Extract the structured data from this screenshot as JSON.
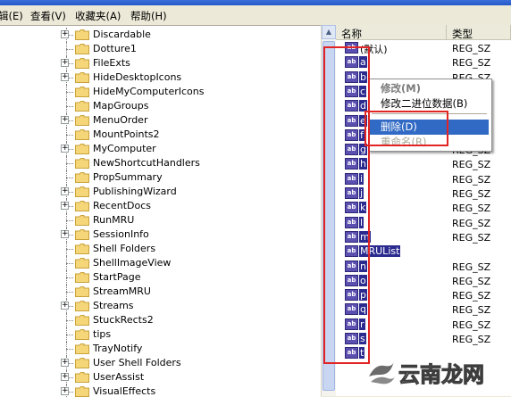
{
  "menubar": {
    "items": [
      {
        "label": "辑(E)",
        "accel_key": "E"
      },
      {
        "label": "查看(V)",
        "accel_key": "V"
      },
      {
        "label": "收藏夹(A)",
        "accel_key": "A"
      },
      {
        "label": "帮助(H)",
        "accel_key": "H"
      }
    ]
  },
  "tree": {
    "items": [
      {
        "label": "Discardable",
        "expandable": true
      },
      {
        "label": "Dotture1",
        "expandable": false
      },
      {
        "label": "FileExts",
        "expandable": true
      },
      {
        "label": "HideDesktopIcons",
        "expandable": true
      },
      {
        "label": "HideMyComputerIcons",
        "expandable": false
      },
      {
        "label": "MapGroups",
        "expandable": false
      },
      {
        "label": "MenuOrder",
        "expandable": true
      },
      {
        "label": "MountPoints2",
        "expandable": false
      },
      {
        "label": "MyComputer",
        "expandable": true
      },
      {
        "label": "NewShortcutHandlers",
        "expandable": false
      },
      {
        "label": "PropSummary",
        "expandable": false
      },
      {
        "label": "PublishingWizard",
        "expandable": true
      },
      {
        "label": "RecentDocs",
        "expandable": true
      },
      {
        "label": "RunMRU",
        "expandable": false
      },
      {
        "label": "SessionInfo",
        "expandable": true
      },
      {
        "label": "Shell Folders",
        "expandable": false
      },
      {
        "label": "ShellImageView",
        "expandable": false
      },
      {
        "label": "StartPage",
        "expandable": false
      },
      {
        "label": "StreamMRU",
        "expandable": false
      },
      {
        "label": "Streams",
        "expandable": true
      },
      {
        "label": "StuckRects2",
        "expandable": false
      },
      {
        "label": "tips",
        "expandable": false
      },
      {
        "label": "TrayNotify",
        "expandable": false
      },
      {
        "label": "User Shell Folders",
        "expandable": true
      },
      {
        "label": "UserAssist",
        "expandable": true
      },
      {
        "label": "VisualEffects",
        "expandable": true
      }
    ]
  },
  "list": {
    "headers": {
      "name": "名称",
      "type": "类型"
    },
    "icon_text": "ab",
    "rows": [
      {
        "name": "(默认)",
        "type": "REG_SZ",
        "selected": false
      },
      {
        "name": "a",
        "type": "REG_SZ",
        "selected": true
      },
      {
        "name": "b",
        "type": "REG_SZ",
        "selected": true
      },
      {
        "name": "c",
        "type": "REG_SZ",
        "selected": true
      },
      {
        "name": "d",
        "type": "REG_SZ",
        "selected": true
      },
      {
        "name": "e",
        "type": "REG_SZ",
        "selected": true
      },
      {
        "name": "f",
        "type": "REG_SZ",
        "selected": true
      },
      {
        "name": "g",
        "type": "REG_SZ",
        "selected": true
      },
      {
        "name": "h",
        "type": "REG_SZ",
        "selected": true
      },
      {
        "name": "i",
        "type": "REG_SZ",
        "selected": true
      },
      {
        "name": "j",
        "type": "REG_SZ",
        "selected": true
      },
      {
        "name": "k",
        "type": "REG_SZ",
        "selected": true
      },
      {
        "name": "l",
        "type": "REG_SZ",
        "selected": true
      },
      {
        "name": "m",
        "type": "REG_SZ",
        "selected": true
      },
      {
        "name": "MRUList",
        "type": "",
        "selected": true
      },
      {
        "name": "n",
        "type": "REG_SZ",
        "selected": true
      },
      {
        "name": "o",
        "type": "REG_SZ",
        "selected": true
      },
      {
        "name": "p",
        "type": "REG_SZ",
        "selected": true
      },
      {
        "name": "q",
        "type": "REG_SZ",
        "selected": true
      },
      {
        "name": "r",
        "type": "REG_SZ",
        "selected": true
      },
      {
        "name": "s",
        "type": "REG_SZ",
        "selected": true
      },
      {
        "name": "t",
        "type": "",
        "selected": true
      }
    ]
  },
  "context_menu": {
    "items": [
      {
        "label": "修改(M)",
        "style": "bold"
      },
      {
        "label": "修改二进位数据(B)",
        "style": "normal"
      },
      {
        "label": "删除(D)",
        "style": "highlight"
      },
      {
        "label": "重命名(R)",
        "style": "disabled"
      }
    ]
  },
  "watermark": {
    "text": "云南龙网"
  },
  "colors": {
    "selection": "#2b2a8f",
    "menu_highlight": "#316ac5",
    "annotation_red": "#e22424"
  }
}
